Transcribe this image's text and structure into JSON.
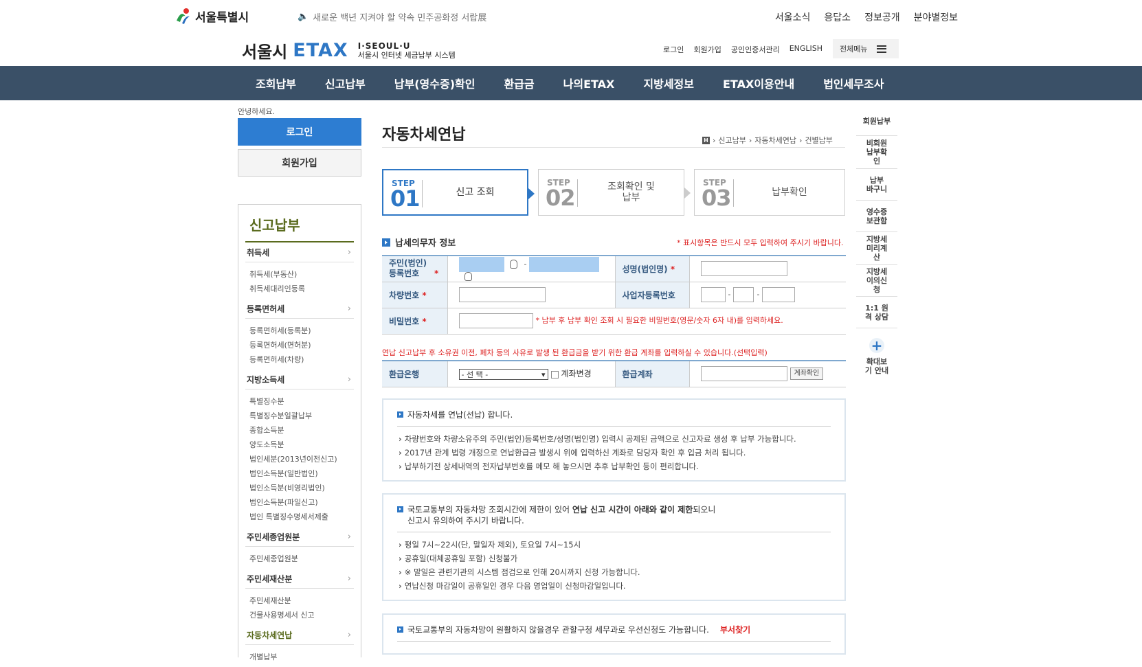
{
  "top": {
    "seoul_logo": "서울특별시",
    "notice": "새로운 백년 지켜야 할 약속 민주공화정 서랍展",
    "links": [
      "서울소식",
      "응답소",
      "정보공개",
      "분야별정보"
    ]
  },
  "brand": {
    "name_kr": "서울시",
    "name_en": "ETAX",
    "slogan": "I·SEOUL·U",
    "desc": "서울시 인터넷 세금납부 시스템",
    "util_links": [
      "로그인",
      "회원가입",
      "공인인증서관리",
      "ENGLISH"
    ],
    "all_menu": "전체메뉴"
  },
  "gnb": [
    "조회납부",
    "신고납부",
    "납부(영수증)확인",
    "환급금",
    "나의ETAX",
    "지방세정보",
    "ETAX이용안내",
    "법인세무조사"
  ],
  "side": {
    "hello": "안녕하세요.",
    "login": "로그인",
    "join": "회원가입",
    "title": "신고납부",
    "groups": [
      {
        "label": "취득세",
        "items": [
          "취득세(부동산)",
          "취득세대리인등록"
        ]
      },
      {
        "label": "등록면허세",
        "items": [
          "등록면허세(등록분)",
          "등록면허세(면허분)",
          "등록면허세(차량)"
        ]
      },
      {
        "label": "지방소득세",
        "items": [
          "특별징수분",
          "특별징수분일괄납부",
          "종합소득분",
          "양도소득분",
          "법인세분(2013년이전신고)",
          "법인소득분(일반법인)",
          "법인소득분(비영리법인)",
          "법인소득분(파일신고)",
          "법인 특별징수명세서제출"
        ]
      },
      {
        "label": "주민세종업원분",
        "items": [
          "주민세종업원분"
        ]
      },
      {
        "label": "주민세재산분",
        "items": [
          "주민세재산분",
          "건물사용명세서 신고"
        ]
      },
      {
        "label": "자동차세연납",
        "items": [
          "개별납부"
        ]
      }
    ]
  },
  "content": {
    "title": "자동차세연납",
    "breadcrumb": [
      "신고납부",
      "자동차세연납",
      "건별납부"
    ],
    "steps": [
      {
        "label": "STEP",
        "num": "01",
        "name": "신고 조회"
      },
      {
        "label": "STEP",
        "num": "02",
        "name": "조회확인 및 납부"
      },
      {
        "label": "STEP",
        "num": "03",
        "name": "납부확인"
      }
    ],
    "section_title": "납세의무자 정보",
    "required_note": "* 표시항목은 반드시 모두 입력하여 주시기 바랍니다.",
    "fields": {
      "resident_no": "주민(법인) 등록번호",
      "name": "성명(법인명)",
      "car_no": "차량번호",
      "biz_no": "사업자등록번호",
      "password": "비밀번호",
      "password_note": "* 납부 후 납부 확인 조회 시 필요한 비밀번호(영문/숫자 6자 내)를 입력하세요."
    },
    "refund_note": "연납 신고납부 후 소유권 이전, 폐차 등의 사유로 발생 된 환급금을 받기 위한 환급 계좌를 입력하실 수 있습니다.(선택입력)",
    "refund": {
      "bank_label": "환급은행",
      "bank_select": "- 선 택 -",
      "change_label": "계좌변경",
      "account_label": "환급계좌",
      "confirm_btn": "계좌확인"
    },
    "box1": {
      "head": "자동차세를 연납(선납) 합니다.",
      "items": [
        "차량번호와 차량소유주의 주민(법인)등록번호/성명(법인명) 입력시 공제된 금액으로 신고자료 생성 후 납부 가능합니다.",
        "2017년 관계 법령 개정으로 연납환급금 발생시 위에 입력하신 계좌로 담당자 확인 후 입금 처리 됩니다.",
        "납부하기전 상세내역의 전자납부번호를 메모 해 놓으시면 추후 납부확인 등이 편리합니다."
      ]
    },
    "box2": {
      "head_a": "국토교통부의 자동차망 조회시간에 제한이 있어 ",
      "head_b": "연납 신고 시간이 아래와 같이 제한",
      "head_c": "되오니",
      "head_d": "신고시 유의하여 주시기 바랍니다.",
      "items": [
        "평일 7시~22시(단, 말일자 제외), 토요일 7시~15시",
        "공휴일(대체공휴일 포함) 신청불가",
        "※ 말일은 관련기관의 시스템 점검으로 인해 20시까지 신청 가능합니다.",
        "연납신청 마감일이 공휴일인 경우 다음 영업일이 신청마감일입니다."
      ]
    },
    "box3": {
      "head": "국토교통부의 자동차망이 원활하지 않을경우 관할구청 세무과로 우선신청도 가능합니다.",
      "link": "부서찾기"
    }
  },
  "quick": [
    "회원납부",
    "비회원 납부확인",
    "납부 바구니",
    "영수증 보관함",
    "지방세 미리계산",
    "지방세 이의신청",
    "1:1 원격 상담",
    "확대보기 안내"
  ],
  "colors": {
    "nav_bg": "#3a5067",
    "accent_blue": "#2e77c5",
    "side_title": "#5a6b1e",
    "required_red": "#d22222"
  }
}
